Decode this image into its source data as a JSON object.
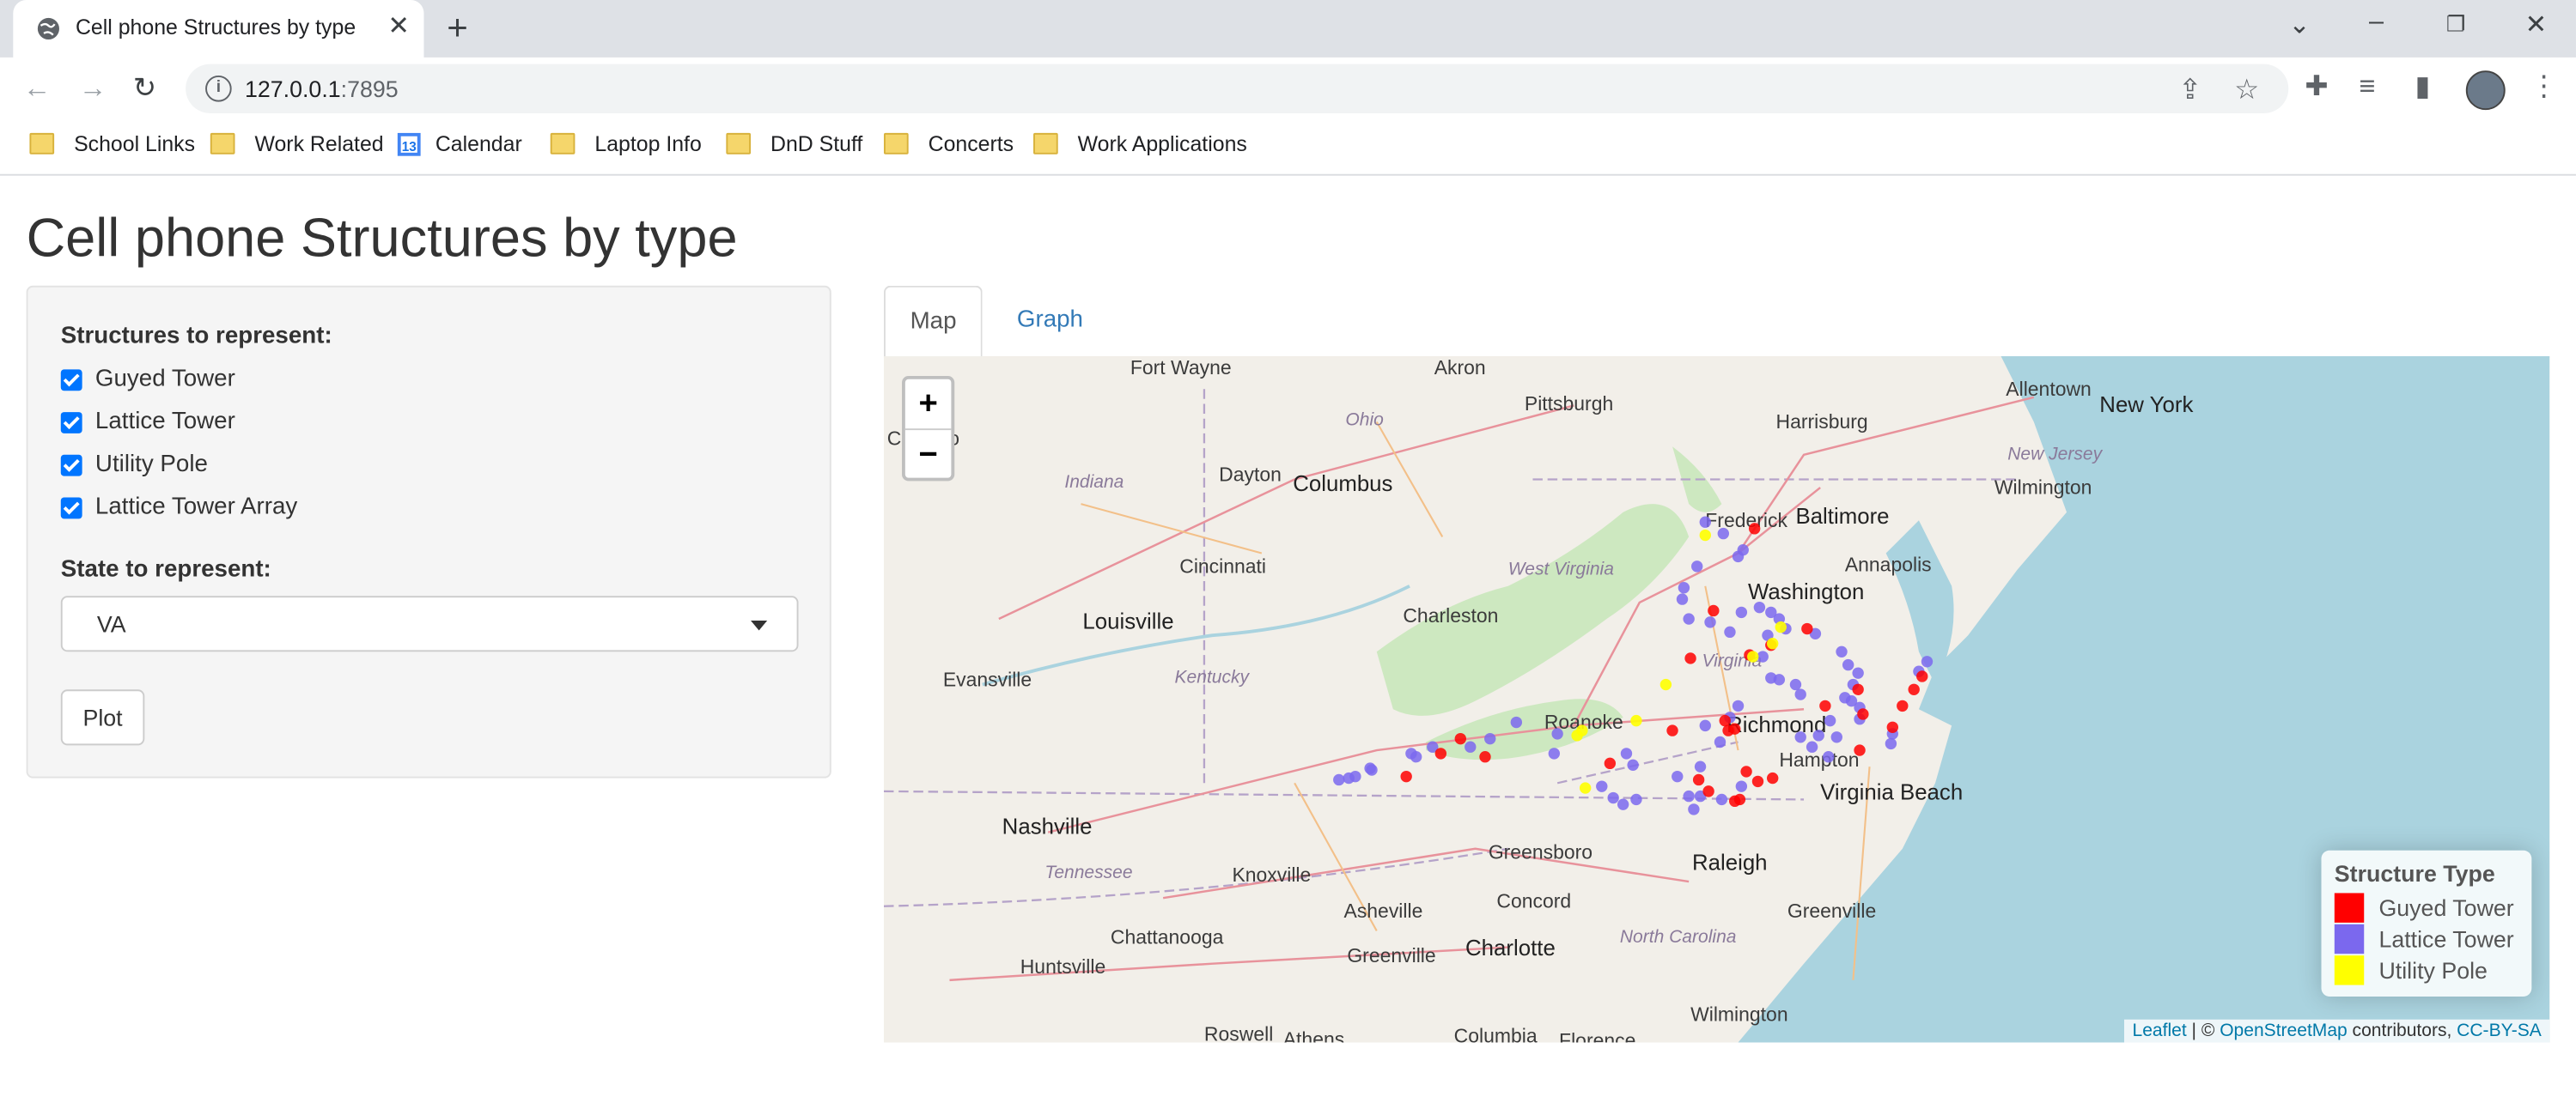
{
  "browser": {
    "tab_title": "Cell phone Structures by type",
    "url_host": "127.0.0.1",
    "url_port": ":7895",
    "bookmarks": [
      "School Links",
      "Work Related",
      "Calendar",
      "Laptop Info",
      "DnD Stuff",
      "Concerts",
      "Work Applications"
    ],
    "calendar_badge": "13"
  },
  "page": {
    "title": "Cell phone Structures by type",
    "structures_label": "Structures to represent:",
    "structures": [
      {
        "label": "Guyed Tower",
        "checked": true
      },
      {
        "label": "Lattice Tower",
        "checked": true
      },
      {
        "label": "Utility Pole",
        "checked": true
      },
      {
        "label": "Lattice Tower Array",
        "checked": true
      }
    ],
    "state_label": "State to represent:",
    "state_value": "VA",
    "plot_button": "Plot",
    "tabs": [
      "Map",
      "Graph"
    ],
    "active_tab": "Map"
  },
  "map": {
    "zoom_in": "+",
    "zoom_out": "−",
    "legend": {
      "title": "Structure Type",
      "items": [
        {
          "label": "Guyed Tower",
          "color": "#ff0000"
        },
        {
          "label": "Lattice Tower",
          "color": "#7b68ee"
        },
        {
          "label": "Utility Pole",
          "color": "#ffff00"
        }
      ]
    },
    "attribution": {
      "leaflet": "Leaflet",
      "sep": " | © ",
      "osm": "OpenStreetMap",
      "contrib": " contributors, ",
      "license": "CC-BY-SA"
    },
    "labels": {
      "fort_wayne": "Fort Wayne",
      "akron": "Akron",
      "allentown": "Allentown",
      "new_york": "New York",
      "pittsburgh": "Pittsburgh",
      "harrisburg": "Harrisburg",
      "chicago": "Chicago",
      "ohio": "Ohio",
      "indiana": "Indiana",
      "dayton": "Dayton",
      "columbus": "Columbus",
      "new_jersey": "New Jersey",
      "wilmington_de": "Wilmington",
      "frederick": "Frederick",
      "baltimore": "Baltimore",
      "cincinnati": "Cincinnati",
      "west_virginia": "West Virginia",
      "annapolis": "Annapolis",
      "washington": "Washington",
      "louisville": "Louisville",
      "charleston": "Charleston",
      "virginia": "Virginia",
      "evansville": "Evansville",
      "kentucky": "Kentucky",
      "roanoke": "Roanoke",
      "richmond": "Richmond",
      "hampton": "Hampton",
      "virginia_beach": "Virginia Beach",
      "nashville": "Nashville",
      "greensboro": "Greensboro",
      "raleigh": "Raleigh",
      "tennessee": "Tennessee",
      "knoxville": "Knoxville",
      "concord": "Concord",
      "asheville": "Asheville",
      "greenville": "Greenville",
      "charlotte": "Charlotte",
      "north_carolina": "North Carolina",
      "chattanooga": "Chattanooga",
      "huntsville": "Huntsville",
      "greenville_sc": "Greenville",
      "wilmington_nc": "Wilmington",
      "roswell": "Roswell",
      "athens": "Athens",
      "columbia": "Columbia",
      "florence": "Florence"
    }
  }
}
